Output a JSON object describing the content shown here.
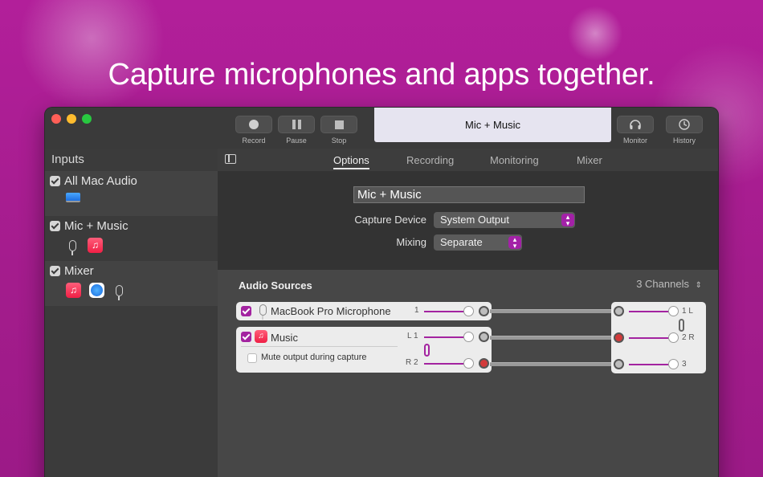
{
  "headline": "Capture microphones and apps together.",
  "window": {
    "traffic_colors": [
      "#ff5f57",
      "#febc2e",
      "#28c840"
    ],
    "toolbar": {
      "record": "Record",
      "pause": "Pause",
      "stop": "Stop",
      "current_source": "Mic + Music",
      "monitor": "Monitor",
      "history": "History"
    },
    "sidebar": {
      "title": "Inputs",
      "items": [
        {
          "label": "All Mac Audio",
          "icons": [
            "macbook-icon"
          ]
        },
        {
          "label": "Mic + Music",
          "icons": [
            "microphone-icon",
            "music-app-icon"
          ]
        },
        {
          "label": "Mixer",
          "icons": [
            "music-app-icon",
            "safari-app-icon",
            "microphone-icon"
          ]
        }
      ]
    },
    "tabs": [
      "Options",
      "Recording",
      "Monitoring",
      "Mixer"
    ],
    "active_tab": "Options",
    "options": {
      "name_value": "Mic + Music",
      "capture_device_label": "Capture Device",
      "capture_device_value": "System Output",
      "mixing_label": "Mixing",
      "mixing_value": "Separate"
    },
    "audio_sources": {
      "title": "Audio Sources",
      "channels": "3 Channels",
      "sources": [
        {
          "name": "MacBook Pro Microphone",
          "channel_labels": [
            "1"
          ]
        },
        {
          "name": "Music",
          "channel_labels": [
            "L 1",
            "R 2"
          ],
          "mute_label": "Mute output during capture"
        }
      ],
      "output_labels": [
        "1 L",
        "2 R",
        "3"
      ]
    },
    "accent_color": "#a323a0"
  }
}
